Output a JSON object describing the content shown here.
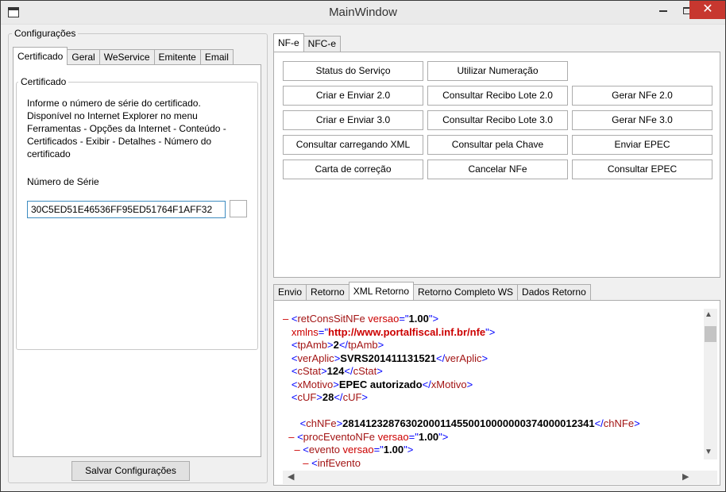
{
  "window": {
    "title": "MainWindow",
    "close": "✕"
  },
  "config": {
    "group_label": "Configurações",
    "tabs": [
      "Certificado",
      "Geral",
      "WeService",
      "Emitente",
      "Email"
    ],
    "cert_group_label": "Certificado",
    "info_lines": [
      "Informe o número de série do certificado.",
      "Disponível no Internet Explorer no menu",
      "Ferramentas - Opções da Internet - Conteúdo -",
      "Certificados - Exibir - Detalhes - Número do",
      "certificado"
    ],
    "serial_label": "Número de Série",
    "serial_value": "30C5ED51E46536FF95ED51764F1AFF32",
    "save_label": "Salvar Configurações"
  },
  "nfe": {
    "tabs": [
      "NF-e",
      "NFC-e"
    ],
    "buttons": [
      "Status do Serviço",
      "Utilizar Numeração",
      "Criar e Enviar 2.0",
      "Consultar Recibo Lote 2.0",
      "Gerar NFe 2.0",
      "Criar e Enviar 3.0",
      "Consultar Recibo Lote 3.0",
      "Gerar NFe 3.0",
      "Consultar carregando XML",
      "Consultar pela Chave",
      "Enviar EPEC",
      "Carta de correção",
      "Cancelar NFe",
      "Consultar EPEC"
    ]
  },
  "ret": {
    "tabs": [
      "Envio",
      "Retorno",
      "XML Retorno",
      "Retorno Completo WS",
      "Dados Retorno"
    ],
    "xml": [
      {
        "parts": [
          [
            "d",
            "– "
          ],
          [
            "b",
            "<"
          ],
          [
            "r",
            "retConsSitNFe"
          ],
          [
            "d",
            " versao"
          ],
          [
            "b",
            "=\""
          ],
          [
            "bold",
            "1.00"
          ],
          [
            "b",
            "\">"
          ]
        ]
      },
      {
        "parts": [
          [
            "d",
            "   xmlns"
          ],
          [
            "b",
            "=\""
          ],
          [
            "dbold",
            "http://www.portalfiscal.inf.br/nfe"
          ],
          [
            "b",
            "\">"
          ]
        ]
      },
      {
        "parts": [
          [
            "b",
            "   <"
          ],
          [
            "r",
            "tpAmb"
          ],
          [
            "b",
            ">"
          ],
          [
            "bold",
            "2"
          ],
          [
            "b",
            "</"
          ],
          [
            "r",
            "tpAmb"
          ],
          [
            "b",
            ">"
          ]
        ]
      },
      {
        "parts": [
          [
            "b",
            "   <"
          ],
          [
            "r",
            "verAplic"
          ],
          [
            "b",
            ">"
          ],
          [
            "bold",
            "SVRS201411131521"
          ],
          [
            "b",
            "</"
          ],
          [
            "r",
            "verAplic"
          ],
          [
            "b",
            ">"
          ]
        ]
      },
      {
        "parts": [
          [
            "b",
            "   <"
          ],
          [
            "r",
            "cStat"
          ],
          [
            "b",
            ">"
          ],
          [
            "bold",
            "124"
          ],
          [
            "b",
            "</"
          ],
          [
            "r",
            "cStat"
          ],
          [
            "b",
            ">"
          ]
        ]
      },
      {
        "parts": [
          [
            "b",
            "   <"
          ],
          [
            "r",
            "xMotivo"
          ],
          [
            "b",
            ">"
          ],
          [
            "bold",
            "EPEC autorizado"
          ],
          [
            "b",
            "</"
          ],
          [
            "r",
            "xMotivo"
          ],
          [
            "b",
            ">"
          ]
        ]
      },
      {
        "parts": [
          [
            "b",
            "   <"
          ],
          [
            "r",
            "cUF"
          ],
          [
            "b",
            ">"
          ],
          [
            "bold",
            "28"
          ],
          [
            "b",
            "</"
          ],
          [
            "r",
            "cUF"
          ],
          [
            "b",
            ">"
          ]
        ]
      },
      {
        "parts": [
          [
            "b",
            " "
          ]
        ]
      },
      {
        "parts": [
          [
            "b",
            "      <"
          ],
          [
            "r",
            "chNFe"
          ],
          [
            "b",
            ">"
          ],
          [
            "bold",
            "28141232876302000114550010000000374000012341"
          ],
          [
            "b",
            "</"
          ],
          [
            "r",
            "chNFe"
          ],
          [
            "b",
            ">"
          ]
        ]
      },
      {
        "parts": [
          [
            "d",
            "  – "
          ],
          [
            "b",
            "<"
          ],
          [
            "r",
            "procEventoNFe"
          ],
          [
            "d",
            " versao"
          ],
          [
            "b",
            "=\""
          ],
          [
            "bold",
            "1.00"
          ],
          [
            "b",
            "\">"
          ]
        ]
      },
      {
        "parts": [
          [
            "d",
            "    – "
          ],
          [
            "b",
            "<"
          ],
          [
            "r",
            "evento"
          ],
          [
            "d",
            " versao"
          ],
          [
            "b",
            "=\""
          ],
          [
            "bold",
            "1.00"
          ],
          [
            "b",
            "\">"
          ]
        ]
      },
      {
        "parts": [
          [
            "d",
            "       – "
          ],
          [
            "b",
            "<"
          ],
          [
            "r",
            "infEvento"
          ]
        ]
      }
    ]
  }
}
